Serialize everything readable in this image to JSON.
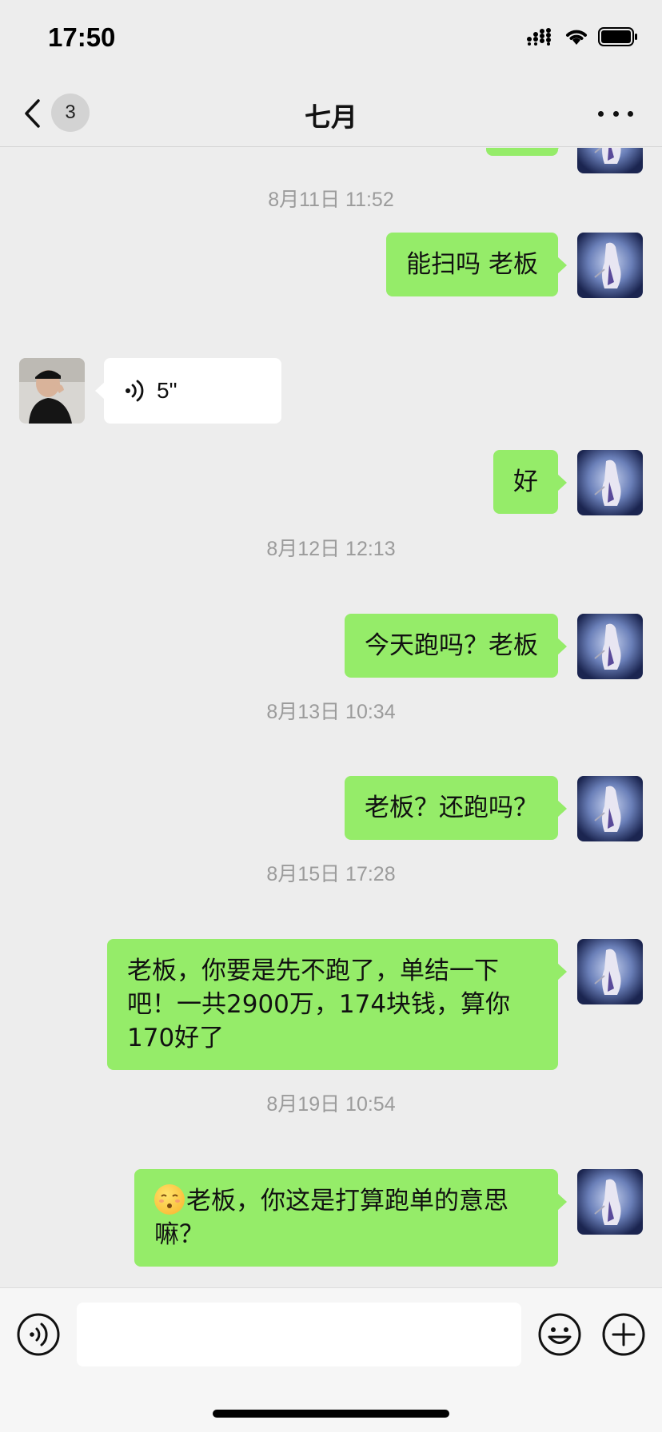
{
  "status_bar": {
    "time": "17:50"
  },
  "nav": {
    "unread_count": "3",
    "title": "七月"
  },
  "messages": [
    {
      "type": "timestamp",
      "text": "8月11日 11:52"
    },
    {
      "type": "text",
      "from": "me",
      "text": "能扫吗 老板"
    },
    {
      "type": "voice",
      "from": "them",
      "duration": "5\""
    },
    {
      "type": "text",
      "from": "me",
      "text": "好"
    },
    {
      "type": "timestamp",
      "text": "8月12日 12:13"
    },
    {
      "type": "text",
      "from": "me",
      "text": "今天跑吗？老板"
    },
    {
      "type": "timestamp",
      "text": "8月13日 10:34"
    },
    {
      "type": "text",
      "from": "me",
      "text": "老板？还跑吗？"
    },
    {
      "type": "timestamp",
      "text": "8月15日 17:28"
    },
    {
      "type": "text",
      "from": "me",
      "text_lines": [
        "老板，你要是先不跑了，单结一下",
        "吧！一共2900万，174块钱，算你",
        "170好了"
      ]
    },
    {
      "type": "timestamp",
      "text": "8月19日 10:54"
    },
    {
      "type": "text",
      "from": "me",
      "emoji": "smirk-emoji",
      "text_lines": [
        "老板，你这是打算跑单的意思",
        "嘛？"
      ]
    }
  ],
  "input": {
    "value": ""
  },
  "colors": {
    "background": "#ededed",
    "my_bubble": "#95ec69",
    "their_bubble": "#ffffff",
    "timestamp": "#9b9b9b"
  },
  "icons": [
    "signal-icon",
    "wifi-icon",
    "battery-icon",
    "back-chevron-icon",
    "more-icon",
    "voice-icon",
    "emoji-icon",
    "plus-icon"
  ]
}
